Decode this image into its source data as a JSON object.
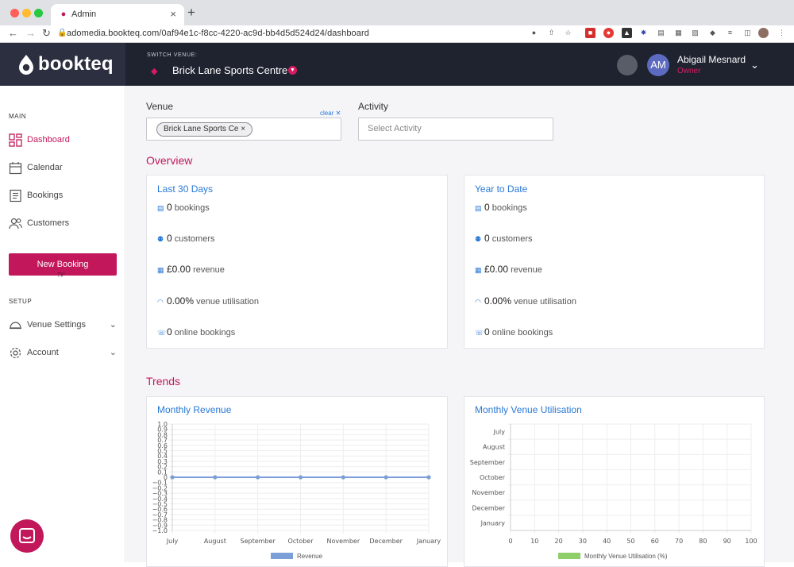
{
  "browser": {
    "tab_title": "Admin",
    "url": "adomedia.bookteq.com/0af94e1c-f8cc-4220-ac9d-bb4d5d524d24/dashboard"
  },
  "header": {
    "logo_text": "bookteq",
    "switch_label": "SWITCH VENUE:",
    "venue_name": "Brick Lane Sports Centre",
    "user_initials": "AM",
    "user_name": "Abigail Mesnard",
    "user_role": "Owner"
  },
  "sidebar": {
    "main_label": "MAIN",
    "items": [
      {
        "label": "Dashboard",
        "icon": "dashboard-icon"
      },
      {
        "label": "Calendar",
        "icon": "calendar-icon"
      },
      {
        "label": "Bookings",
        "icon": "bookings-icon"
      },
      {
        "label": "Customers",
        "icon": "customers-icon"
      }
    ],
    "new_booking": "New Booking",
    "setup_label": "SETUP",
    "setup_items": [
      {
        "label": "Venue Settings",
        "icon": "settings-icon"
      },
      {
        "label": "Account",
        "icon": "gear-icon"
      }
    ]
  },
  "filters": {
    "venue_label": "Venue",
    "venue_chip": "Brick Lane Sports Ce",
    "clear": "clear",
    "activity_label": "Activity",
    "activity_placeholder": "Select Activity"
  },
  "overview": {
    "title": "Overview",
    "cards": [
      {
        "title": "Last 30 Days",
        "stats": [
          {
            "value": "0",
            "label": "bookings"
          },
          {
            "value": "0",
            "label": "customers"
          },
          {
            "value": "£0.00",
            "label": "revenue"
          },
          {
            "value": "0.00%",
            "label": "venue utilisation"
          },
          {
            "value": "0",
            "label": "online bookings"
          }
        ]
      },
      {
        "title": "Year to Date",
        "stats": [
          {
            "value": "0",
            "label": "bookings"
          },
          {
            "value": "0",
            "label": "customers"
          },
          {
            "value": "£0.00",
            "label": "revenue"
          },
          {
            "value": "0.00%",
            "label": "venue utilisation"
          },
          {
            "value": "0",
            "label": "online bookings"
          }
        ]
      }
    ]
  },
  "trends": {
    "title": "Trends",
    "revenue_title": "Monthly Revenue",
    "utilisation_title": "Monthly Venue Utilisation"
  },
  "colors": {
    "brand": "#c2185b",
    "link": "#2979d6",
    "revenue_series": "#7b9fd6",
    "utilisation_series": "#8ecf6a"
  },
  "chart_data": [
    {
      "type": "line",
      "title": "Monthly Revenue",
      "categories": [
        "July",
        "August",
        "September",
        "October",
        "November",
        "December",
        "January"
      ],
      "series": [
        {
          "name": "Revenue",
          "values": [
            0,
            0,
            0,
            0,
            0,
            0,
            0
          ]
        }
      ],
      "yticks": [
        "1.0",
        "0.9",
        "0.8",
        "0.7",
        "0.6",
        "0.5",
        "0.4",
        "0.3",
        "0.2",
        "0.1",
        "0",
        "−0.1",
        "−0.2",
        "−0.3",
        "−0.4",
        "−0.5",
        "−0.6",
        "−0.7",
        "−0.8",
        "−0.9",
        "−1.0"
      ],
      "ylim": [
        -1.0,
        1.0
      ],
      "grid": true,
      "legend": "bottom"
    },
    {
      "type": "bar",
      "orientation": "horizontal",
      "title": "Monthly Venue Utilisation",
      "categories": [
        "July",
        "August",
        "September",
        "October",
        "November",
        "December",
        "January"
      ],
      "series": [
        {
          "name": "Monthly Venue Utilisation (%)",
          "values": [
            0,
            0,
            0,
            0,
            0,
            0,
            0
          ]
        }
      ],
      "xticks": [
        "0",
        "10",
        "20",
        "30",
        "40",
        "50",
        "60",
        "70",
        "80",
        "90",
        "100"
      ],
      "xlim": [
        0,
        100
      ],
      "grid": true,
      "legend": "bottom"
    }
  ]
}
